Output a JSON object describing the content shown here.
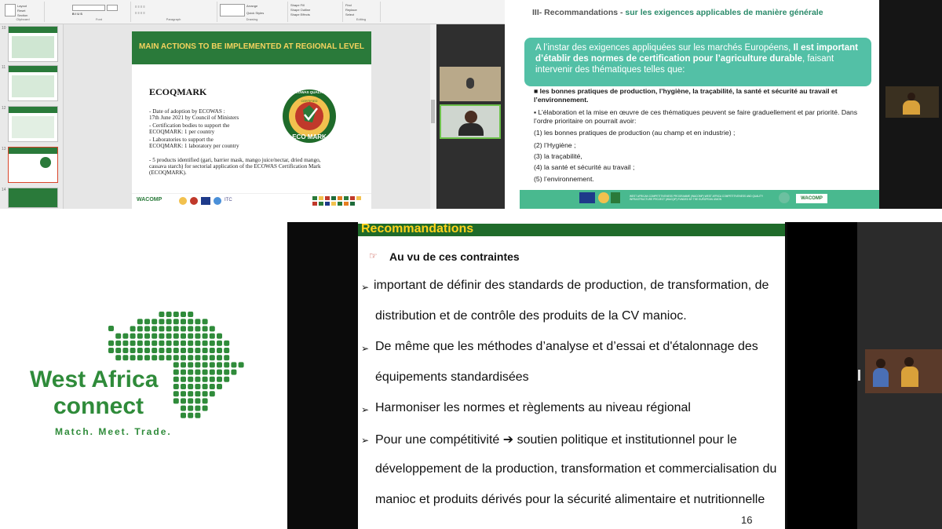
{
  "ppt": {
    "ribbon_groups": [
      "Clipboard",
      "Font",
      "Paragraph",
      "Drawing",
      "Editing"
    ],
    "ribbon_buttons": [
      "Layout",
      "Reset",
      "Section",
      "Arrange",
      "Quick Styles",
      "Shape Fill",
      "Shape Outline",
      "Shape Effects",
      "Find",
      "Replace",
      "Select"
    ],
    "thumb_numbers": [
      "10",
      "11",
      "12",
      "13",
      "14"
    ],
    "slide": {
      "banner": "MAIN ACTIONS TO BE IMPLEMENTED AT REGIONAL LEVEL",
      "title": "ECOQMARK",
      "lines": [
        "-   Date of adoption by ECOWAS  :",
        "     17th June 2021 by Council of Ministers",
        "-   Certification bodies to support the",
        "     ECOQMARK: 1 per country",
        "-   Laboratories to support the",
        "     ECOQMARK: 1 laboratory per country",
        "-   5 products identified (gari, barrier mask, mango juice/nectar, dried mango,",
        "     cassava starch) for sectorial application of the ECOWAS Certification Mark",
        "     (ECOQMARK)."
      ],
      "seal_top": "ECOWAS QUALITY",
      "seal_sub": "CERTIFIED",
      "seal_bottom": "ECO MARK",
      "footer_logo": "WACOMP",
      "footer_itc": "ITC"
    }
  },
  "fr_slide": {
    "header_prefix": "III- Recommandations -",
    "header_suffix": " sur les exigences applicables de manière générale",
    "callout_a": "A l’instar des exigences appliquées sur les marchés Européens, ",
    "callout_b": "Il est important d’établir des normes de certification pour l’agriculture durable",
    "callout_c": ", faisant intervenir des thématiques telles que:",
    "bullet1": "les bonnes pratiques de production, l’hygiène, la traçabilité, la santé et sécurité au travail et l’environnement.",
    "bullet2": "L’élaboration et la mise en œuvre de ces thématiques peuvent se faire graduellement et par priorité. Dans l’ordre prioritaire on pourrait avoir:",
    "items": [
      "(1) les bonnes pratiques de production (au champ et en industrie) ;",
      "(2) l’Hygiène ;",
      "(3) la traçabilité,",
      "(4) la santé et sécurité au travail ;",
      "(5) l’environnement."
    ],
    "footer_note": "WEST AFRICAN COMPETITIVENESS PROGRAMME (WACOMP) WEST AFRICA COMPETITIVENESS AND QUALITY INFRASTRUCTURE PROJECT (WACQIP) FUNDED BY THE EUROPEAN UNION",
    "footer_logo": "WACOMP"
  },
  "brand": {
    "line1": "West Africa",
    "line2": "connect",
    "tagline": "Match. Meet. Trade."
  },
  "rec_slide": {
    "title": "Recommandations",
    "subtitle": "Au vu de ces contraintes",
    "lines": [
      " important de définir des standards de production, de transformation, de",
      "distribution et de contrôle des produits de la CV manioc.",
      "De même que les méthodes d’analyse et d’essai et d'étalonnage des",
      "équipements standardisées",
      "Harmoniser les normes et règlements au niveau régional",
      "Pour une compétitivité ➔ soutien politique et institutionnel pour le",
      "développement de la production, transformation et commercialisation du",
      "manioc et produits dérivés pour la sécurité alimentaire et nutritionnelle"
    ],
    "page_number": "16"
  },
  "colors": {
    "green_dark": "#1f6b2a",
    "green_brand": "#2f8b3a",
    "teal": "#53c0a6",
    "yellow": "#ffd21a"
  }
}
